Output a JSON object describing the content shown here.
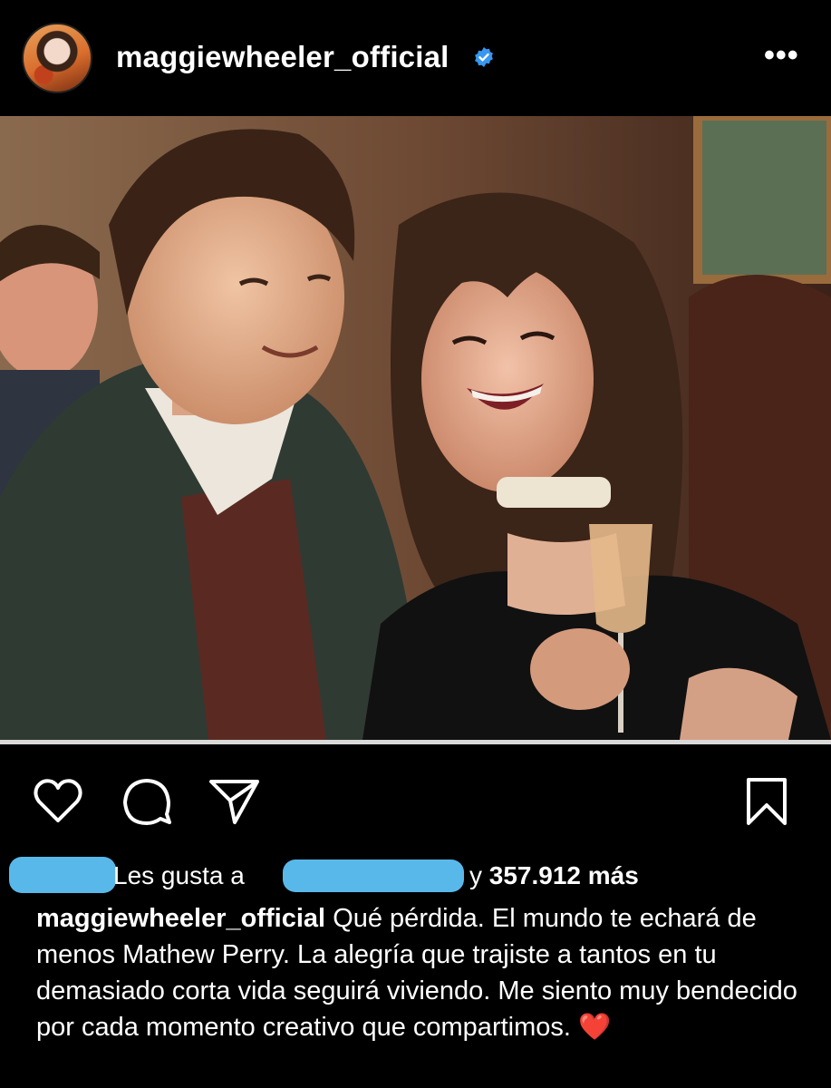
{
  "post": {
    "username": "maggiewheeler_official",
    "verified": true,
    "more_label": "•••",
    "image_alt": "Photo of a man in a green jacket and a laughing woman with curly hair holding a champagne glass"
  },
  "actions": {
    "like_icon": "heart-icon",
    "comment_icon": "comment-icon",
    "share_icon": "send-icon",
    "save_icon": "bookmark-icon"
  },
  "likes": {
    "prefix": "Les gusta a",
    "conjunction": "y",
    "count": "357.912 más"
  },
  "caption": {
    "username": "maggiewheeler_official",
    "text": "Qué pérdida. El mundo te echará de menos Mathew Perry. La alegría que trajiste a tantos en tu demasiado corta vida seguirá viviendo. Me siento muy bendecido por cada momento creativo que compartimos.",
    "emoji": "❤️"
  },
  "colors": {
    "background": "#000000",
    "verified_blue": "#3897f0",
    "redaction_blue": "#59b8ea",
    "heart_red": "#e0242c"
  }
}
